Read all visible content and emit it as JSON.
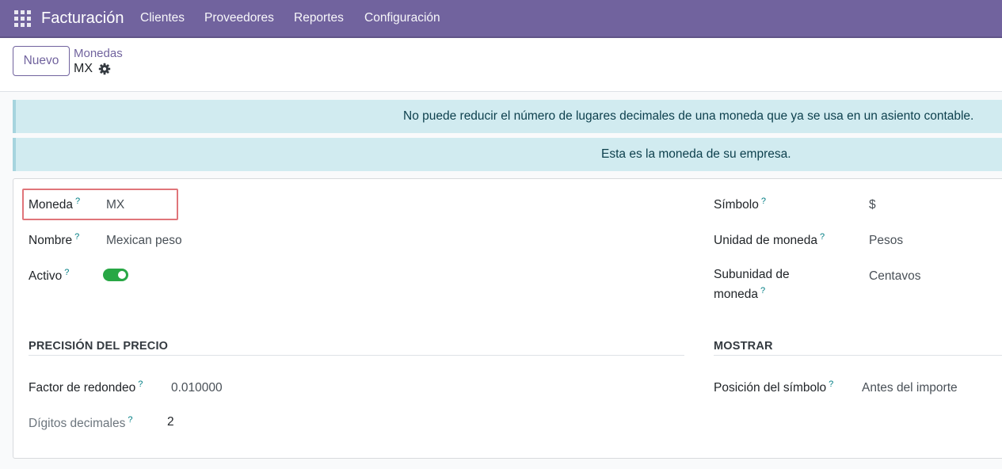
{
  "navbar": {
    "icon": "apps-grid-icon",
    "brand": "Facturación",
    "menu": [
      "Clientes",
      "Proveedores",
      "Reportes",
      "Configuración"
    ],
    "color": "#71639e"
  },
  "control_panel": {
    "new_button": "Nuevo",
    "breadcrumb_parent": "Monedas",
    "breadcrumb_current": "MX",
    "actions_icon": "gear-icon"
  },
  "alerts": [
    "No puede reducir el número de lugares decimales de una moneda que ya se usa en un asiento contable.",
    "Esta es la moneda de su empresa."
  ],
  "form": {
    "help_marker": "?",
    "currency_label": "Moneda",
    "currency_value": "MX",
    "name_label": "Nombre",
    "name_value": "Mexican peso",
    "active_label": "Activo",
    "active_value": true,
    "symbol_label": "Símbolo",
    "symbol_value": "$",
    "unit_label": "Unidad de moneda",
    "unit_value": "Pesos",
    "subunit_label_line1": "Subunidad de",
    "subunit_label_line2": "moneda",
    "subunit_value": "Centavos",
    "price_section": "PRECISIÓN DEL PRECIO",
    "display_section": "MOSTRAR",
    "rounding_label": "Factor de redondeo",
    "rounding_value": "0.010000",
    "decimals_label": "Dígitos decimales",
    "decimals_value": "2",
    "position_label": "Posición del símbolo",
    "position_value": "Antes del importe"
  }
}
